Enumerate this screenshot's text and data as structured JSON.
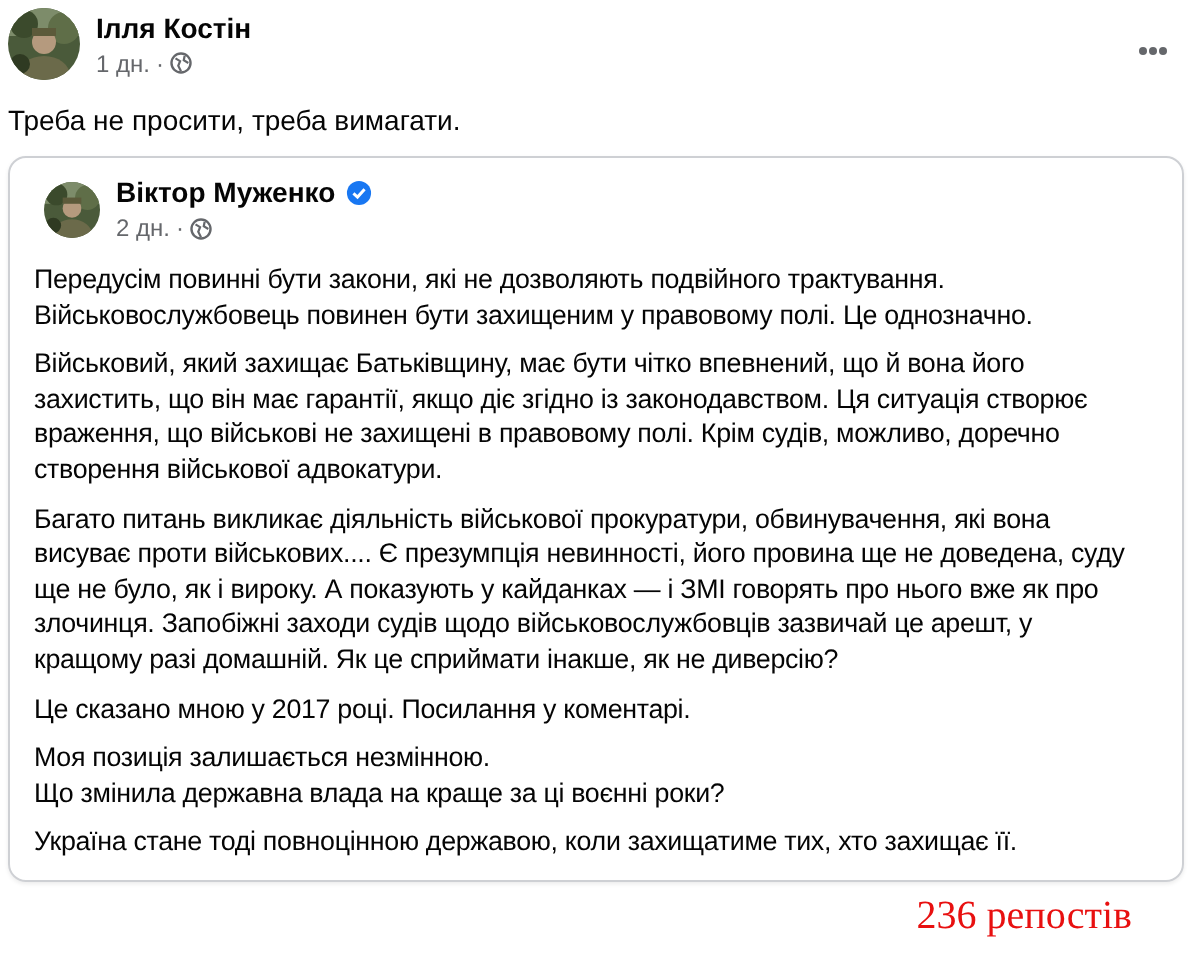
{
  "post": {
    "author": "Ілля Костін",
    "time": "1 дн.",
    "separator": "·",
    "text": "Треба не просити, треба вимагати."
  },
  "shared_post": {
    "author": "Віктор Муженко",
    "verified": true,
    "time": "2 дн.",
    "separator": "·",
    "paragraphs": [
      [
        "Передусім повинні бути закони, які не дозволяють подвійного трактування.",
        "Військовослужбовець повинен бути захищеним у правовому полі. Це однозначно."
      ],
      [
        "Військовий, який захищає Батьківщину, має бути чітко впевнений, що й вона його",
        "захистить, що він має гарантії, якщо діє згідно із законодавством. Ця ситуація створює",
        "враження, що військові не захищені в правовому полі. Крім судів, можливо, доречно",
        "створення військової адвокатури."
      ],
      [
        "Багато питань викликає діяльність військової прокуратури, обвинувачення, які вона",
        "висуває проти військових.... Є презумпція невинності, його провина ще не доведена, суду",
        "ще не було, як і вироку. А показують у кайданках — і ЗМІ говорять про нього вже як про",
        "злочинця. Запобіжні заходи судів щодо військовослужбовців зазвичай це арешт, у",
        "кращому разі домашній. Як це сприймати інакше, як не диверсію?"
      ],
      [
        "Це сказано мною у 2017 році. Посилання у коментарі."
      ],
      [
        "Моя позиція залишається незмінною.",
        "Що змінила державна влада на краще за ці воєнні роки?"
      ],
      [
        "Україна стане тоді повноцінною державою, коли захищатиме тих, хто захищає її."
      ]
    ]
  },
  "repost_count": "236 репостів"
}
